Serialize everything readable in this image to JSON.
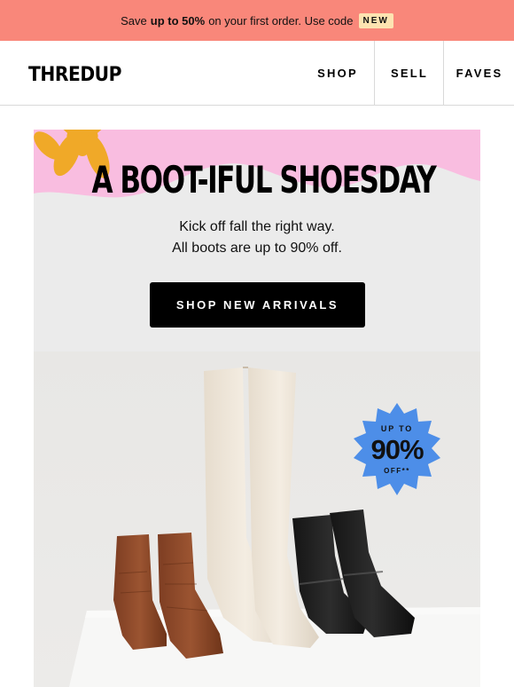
{
  "promo": {
    "prefix": "Save",
    "highlight": "up to 50%",
    "suffix": "on your first order. Use code",
    "code": "NEW"
  },
  "nav": {
    "logo": "THREDUP",
    "links": [
      "SHOP",
      "SELL",
      "FAVES"
    ]
  },
  "hero": {
    "headline": "A BOOT-IFUL SHOESDAY",
    "sub_line1": "Kick off fall the right way.",
    "sub_line2": "All boots are up to 90% off.",
    "cta": "SHOP NEW ARRIVALS",
    "badge": {
      "line1": "UP TO",
      "line2": "90%",
      "line3": "OFF**"
    }
  },
  "colors": {
    "promo_bg": "#f9877a",
    "code_bg": "#fde3b1",
    "pink_accent": "#f9bde0",
    "flower": "#f0a928",
    "badge": "#4d8ee8",
    "cta_bg": "#000000"
  }
}
